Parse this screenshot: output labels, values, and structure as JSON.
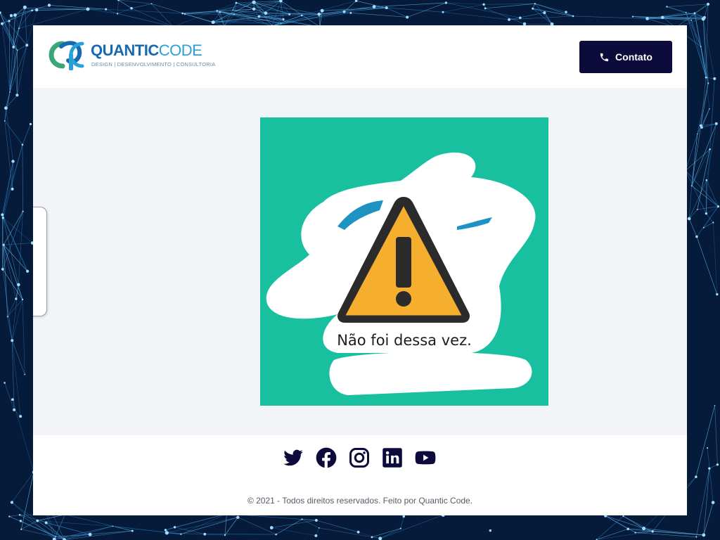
{
  "header": {
    "logo": {
      "word_primary": "QUANTIC",
      "word_secondary": "CODE",
      "tagline": "DESIGN | DESENVOLVIMENTO | CONSULTORIA"
    },
    "contact_button": {
      "label": "Contato",
      "icon": "phone-icon"
    }
  },
  "main": {
    "error_image": {
      "message": "Não foi dessa vez.",
      "icon": "warning-icon",
      "background_color": "#19c0a0",
      "warning_color": "#f5ae2e"
    }
  },
  "footer": {
    "social_links": [
      {
        "icon": "twitter-icon"
      },
      {
        "icon": "facebook-icon"
      },
      {
        "icon": "instagram-icon"
      },
      {
        "icon": "linkedin-icon"
      },
      {
        "icon": "youtube-icon"
      }
    ],
    "copyright": "© 2021 - Todos direitos reservados. Feito por Quantic Code."
  },
  "colors": {
    "brand_dark": "#0c0b3b",
    "brand_blue": "#1769b0",
    "brand_cyan": "#2aa0d8"
  }
}
